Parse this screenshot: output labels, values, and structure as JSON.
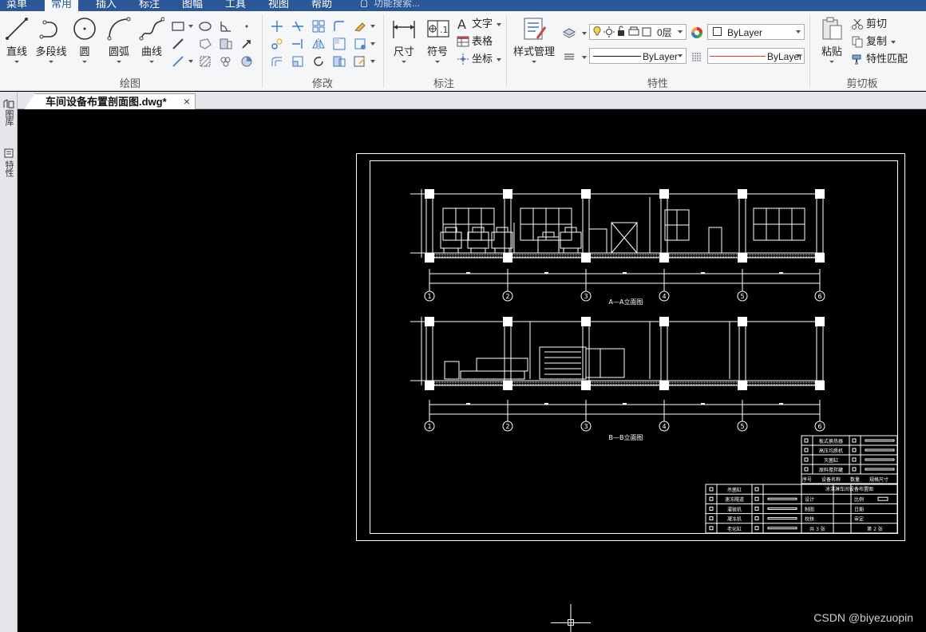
{
  "menubar": {
    "tabs": [
      "菜单",
      "常用",
      "插入",
      "标注",
      "图幅",
      "工具",
      "视图",
      "帮助"
    ],
    "active_tab": "常用",
    "search_placeholder": "功能搜索..."
  },
  "ribbon": {
    "draw_group": {
      "title": "绘图",
      "buttons": [
        "直线",
        "多段线",
        "圆",
        "圆弧",
        "曲线"
      ]
    },
    "modify_group": {
      "title": "修改"
    },
    "annotate_group": {
      "title": "标注",
      "dimension_label": "尺寸",
      "symbol_label": "符号",
      "text_label": "文字",
      "table_label": "表格",
      "coordinate_label": "坐标"
    },
    "properties_group": {
      "title": "特性",
      "style_manager_label": "样式管理",
      "layer_value": "0层",
      "color_value": "ByLayer",
      "linetype_value": "ByLayer",
      "lineweight_value": "ByLayer"
    },
    "clipboard_group": {
      "title": "剪切板",
      "paste_label": "粘贴",
      "cut_label": "剪切",
      "copy_label": "复制",
      "match_label": "特性匹配"
    }
  },
  "document": {
    "tab_title": "车间设备布置剖面图.dwg*",
    "close_glyph": "×"
  },
  "left_dock": {
    "layers_label": "图库",
    "properties_label": "特性"
  },
  "drawing": {
    "section_aa_label": "A—A立面图",
    "section_bb_label": "B—B立面图",
    "axis_numbers": [
      "1",
      "2",
      "3",
      "4",
      "5",
      "6"
    ],
    "equipment_table": [
      {
        "name": "板式换热器"
      },
      {
        "name": "高压均质机"
      },
      {
        "name": "灭菌缸"
      },
      {
        "name": "原料搅拌罐"
      }
    ],
    "equipment_header": [
      "序号",
      "设备名称",
      "数量",
      "规格尺寸"
    ],
    "title_block": {
      "drawing_title": "冰淇淋车间设备布置图",
      "row_labels": [
        "杀菌缸",
        "速冻隧道",
        "灌装机",
        "凝冻机",
        "老化缸"
      ],
      "role_labels": [
        "设计",
        "制图",
        "校核"
      ],
      "right_labels": [
        "比例",
        "日期",
        "审定"
      ],
      "sheet_total": "共 3 张",
      "sheet_number": "第 2 张"
    }
  },
  "watermark": "CSDN @biyezuopin",
  "colors": {
    "ribbon_bg": "#f5f6f7",
    "menubar_bg": "#2b5797",
    "canvas_bg": "#000000",
    "cad_line": "#ffffff",
    "linetype_red": "#e0322d"
  }
}
